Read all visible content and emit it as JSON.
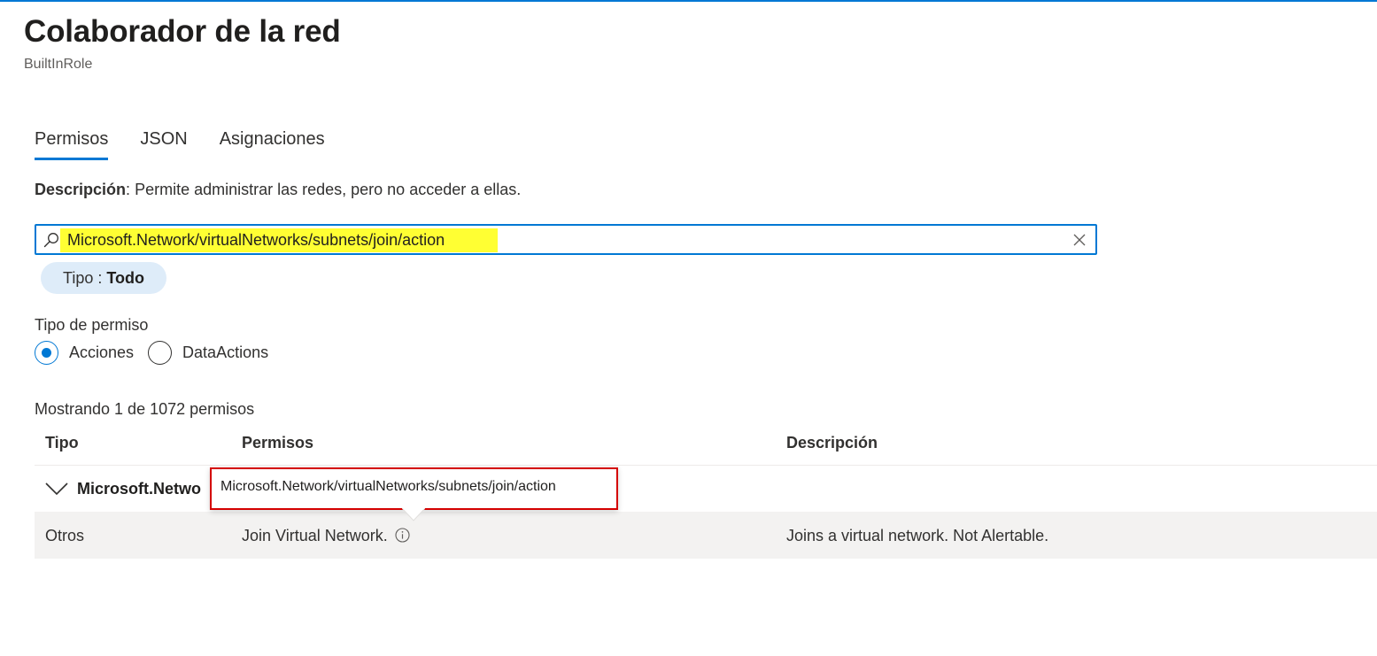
{
  "header": {
    "title": "Colaborador de la red",
    "subtitle": "BuiltInRole"
  },
  "tabs": [
    {
      "label": "Permisos",
      "active": true
    },
    {
      "label": "JSON",
      "active": false
    },
    {
      "label": "Asignaciones",
      "active": false
    }
  ],
  "description": {
    "label": "Descripción",
    "separator": ":",
    "text": " Permite administrar las redes, pero no acceder a ellas."
  },
  "search": {
    "value": "Microsoft.Network/virtualNetworks/subnets/join/action",
    "highlight_color": "#ffff33"
  },
  "filter": {
    "label": "Tipo : ",
    "value": "Todo"
  },
  "permission_type": {
    "label": "Tipo de permiso",
    "options": [
      {
        "label": "Acciones",
        "checked": true
      },
      {
        "label": "DataActions",
        "checked": false
      }
    ]
  },
  "results": {
    "count_text": "Mostrando 1 de 1072 permisos"
  },
  "table": {
    "columns": [
      "Tipo",
      "Permisos",
      "Descripción"
    ],
    "group": {
      "label": "Microsoft.Netwo"
    },
    "rows": [
      {
        "tipo": "Otros",
        "permisos": "Join Virtual Network.",
        "descripcion": "Joins a virtual network. Not Alertable."
      }
    ]
  },
  "tooltip": {
    "text": "Microsoft.Network/virtualNetworks/subnets/join/action",
    "border_color": "#d40000"
  },
  "colors": {
    "accent": "#0078d4",
    "pill_bg": "#deecf9",
    "row_bg": "#f3f2f1"
  },
  "icons": {
    "search": "search-icon",
    "clear": "close-icon",
    "chevron": "chevron-down-icon",
    "info": "info-icon"
  }
}
